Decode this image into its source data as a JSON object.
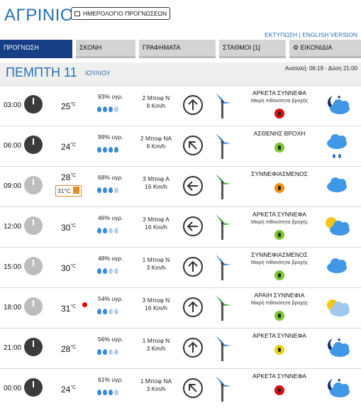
{
  "city": "ΑΓΡΙΝΙΟ",
  "calendar_button": "ΗΜΕΡΟΛΟΓΙΟ ΠΡΟΓΝΩΣΕΩΝ",
  "print_links": "ΕΚΤΥΠΩΣΗ | ENGLISH VERSION",
  "tabs": [
    "ΠΡΟΓΝΩΣΗ",
    "ΣΚΟΝΗ",
    "ΓΡΑΦΗΜΑΤΑ",
    "ΣΤΑΘΜΟΙ [1]",
    "ΕΙΚΟΝΙΔΙΑ"
  ],
  "day": {
    "name": "ΠΕΜΠΤΗ 11",
    "month": "ΙΟΥΛΙΟΥ",
    "sun": "Ανατολή: 06:19 - Δύση 21:00"
  },
  "rows": [
    {
      "time": "03:00",
      "temp": "25",
      "feels": "",
      "hum": "93% υγρ.",
      "drops": 3,
      "wind_bf": "2 Μποφ Ν",
      "wind_kmh": "9 Km/h",
      "cond": "ΑΡΚΕΤΑ ΣΥΝΝΕΦΑ",
      "sub": "Μικρή πιθανότητα βροχής"
    },
    {
      "time": "06:00",
      "temp": "24",
      "feels": "",
      "hum": "99% υγρ.",
      "drops": 4,
      "wind_bf": "2 Μποφ ΝΑ",
      "wind_kmh": "9 Km/h",
      "cond": "ΑΣΘΕΝΗΣ ΒΡΟΧΗ",
      "sub": ""
    },
    {
      "time": "09:00",
      "temp": "28",
      "feels": "31°C",
      "hum": "68% υγρ.",
      "drops": 3,
      "wind_bf": "3 Μποφ Α",
      "wind_kmh": "16 Km/h",
      "cond": "ΣΥΝΝΕΦΙΑΣΜΕΝΟΣ",
      "sub": ""
    },
    {
      "time": "12:00",
      "temp": "30",
      "feels": "",
      "hum": "46% υγρ.",
      "drops": 2,
      "wind_bf": "3 Μποφ Α",
      "wind_kmh": "16 Km/h",
      "cond": "ΑΡΚΕΤΑ ΣΥΝΝΕΦΑ",
      "sub": "Μικρή πιθανότητα βροχής"
    },
    {
      "time": "15:00",
      "temp": "30",
      "feels": "",
      "hum": "48% υγρ.",
      "drops": 2,
      "wind_bf": "1 Μποφ Ν",
      "wind_kmh": "3 Km/h",
      "cond": "ΣΥΝΝΕΦΙΑΣΜΕΝΟΣ",
      "sub": "Μικρή πιθανότητα βροχής"
    },
    {
      "time": "18:00",
      "temp": "31",
      "feels": "",
      "hum": "54% υγρ.",
      "drops": 2,
      "wind_bf": "3 Μποφ Ν",
      "wind_kmh": "16 Km/h",
      "cond": "ΑΡΑΙΗ ΣΥΝΝΕΦΙΑ",
      "sub": "Μικρή πιθανότητα βροχής"
    },
    {
      "time": "21:00",
      "temp": "28",
      "feels": "",
      "hum": "56% υγρ.",
      "drops": 2,
      "wind_bf": "1 Μποφ Ν",
      "wind_kmh": "3 Km/h",
      "cond": "ΑΡΚΕΤΑ ΣΥΝΝΕΦΑ",
      "sub": ""
    },
    {
      "time": "00:00",
      "temp": "24",
      "feels": "",
      "hum": "61% υγρ.",
      "drops": 3,
      "wind_bf": "1 Μποφ ΝΑ",
      "wind_kmh": "3 Km/h",
      "cond": "ΑΡΚΕΤΑ ΣΥΝΝΕΦΑ",
      "sub": ""
    }
  ],
  "temp_unit": "°C"
}
